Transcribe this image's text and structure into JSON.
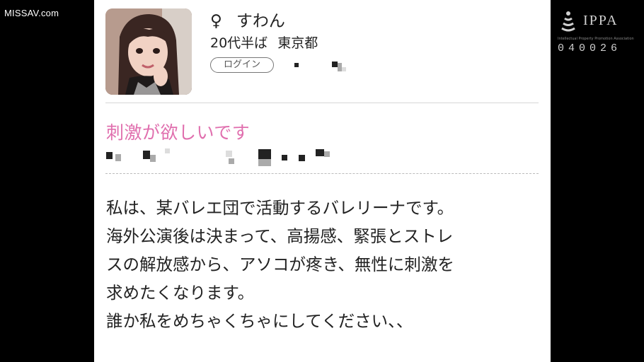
{
  "watermark": "MISSAV.com",
  "profile": {
    "gender_symbol": "♀",
    "name": "すわん",
    "age": "20代半ば",
    "location": "東京都",
    "login_label": "ログイン"
  },
  "post": {
    "headline": "刺激が欲しいです",
    "body_lines": [
      "私は、某バレエ団で活動するバレリーナです。",
      "海外公演後は決まって、高揚感、緊張とストレ",
      "スの解放感から、アソコが疼き、無性に刺激を",
      "求めたくなります。",
      "誰か私をめちゃくちゃにしてください、、"
    ]
  },
  "badge": {
    "logo": "IPPA",
    "subtitle": "Intellectual Property Promotion Association",
    "code": "040026"
  },
  "colors": {
    "headline": "#e06fae",
    "background": "#000000",
    "panel": "#ffffff"
  }
}
